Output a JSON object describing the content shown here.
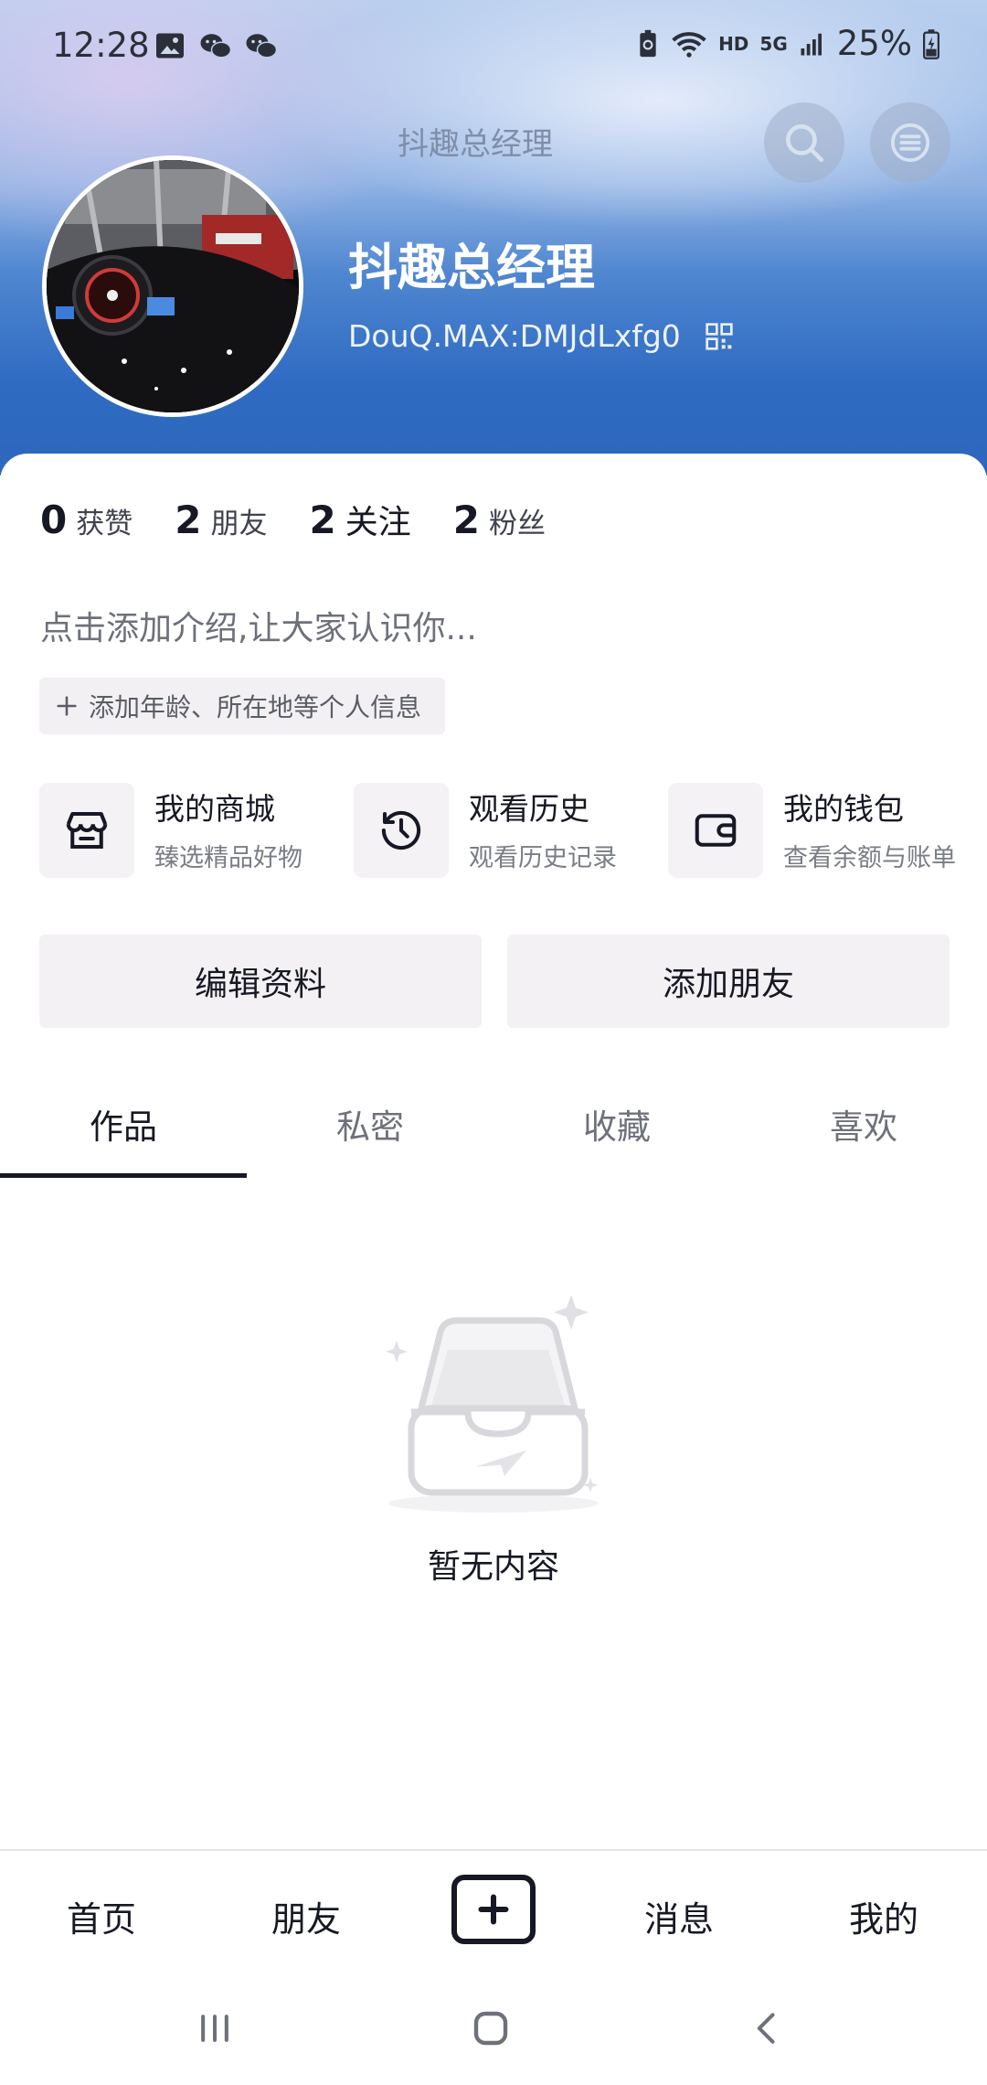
{
  "status_bar": {
    "time": "12:28",
    "network": "HD",
    "signal": "5G",
    "battery": "25%"
  },
  "nav": {
    "title": "抖趣总经理"
  },
  "profile": {
    "name": "抖趣总经理",
    "id_text": "DouQ.MAX:DMJdLxfg0"
  },
  "stats": [
    {
      "value": "0",
      "label": "获赞"
    },
    {
      "value": "2",
      "label": "朋友"
    },
    {
      "value": "2",
      "label": "关注"
    },
    {
      "value": "2",
      "label": "粉丝"
    }
  ],
  "bio_placeholder": "点击添加介绍,让大家认识你...",
  "add_info_label": "添加年龄、所在地等个人信息",
  "shortcuts": [
    {
      "title": "我的商城",
      "subtitle": "臻选精品好物",
      "icon": "store-icon"
    },
    {
      "title": "观看历史",
      "subtitle": "观看历史记录",
      "icon": "history-icon"
    },
    {
      "title": "我的钱包",
      "subtitle": "查看余额与账单",
      "icon": "wallet-icon"
    }
  ],
  "actions": {
    "edit_profile": "编辑资料",
    "add_friend": "添加朋友"
  },
  "tabs": [
    {
      "label": "作品",
      "active": true
    },
    {
      "label": "私密",
      "active": false
    },
    {
      "label": "收藏",
      "active": false
    },
    {
      "label": "喜欢",
      "active": false
    }
  ],
  "empty_state": {
    "text": "暂无内容"
  },
  "bottom_nav": {
    "home": "首页",
    "friends": "朋友",
    "messages": "消息",
    "me": "我的"
  },
  "colors": {
    "header_blue": "#2f6bc2",
    "text_primary": "#161823",
    "text_secondary": "#6e717a",
    "button_bg": "#f4f1f5"
  }
}
